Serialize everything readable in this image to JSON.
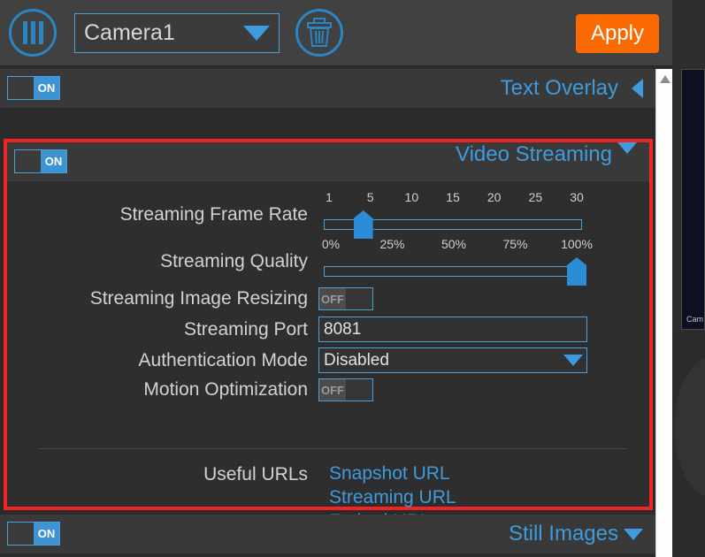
{
  "toolbar": {
    "menu_icon": "bars-icon",
    "camera_select": {
      "value": "Camera1",
      "dropdown_icon": "chevron-down-icon"
    },
    "delete_icon": "trash-icon",
    "apply_label": "Apply"
  },
  "scrollbar": {
    "up_arrow_icon": "scroll-up-arrow-icon"
  },
  "preview": {
    "camera_label": "Cam"
  },
  "sections": {
    "text_overlay": {
      "title": "Text Overlay",
      "toggle": "ON",
      "collapsed_icon": "chevron-left-icon"
    },
    "video_streaming": {
      "title": "Video Streaming",
      "toggle": "ON",
      "expanded_icon": "chevron-down-icon"
    },
    "still_images": {
      "title": "Still Images",
      "toggle": "ON",
      "expanded_icon": "chevron-down-icon"
    }
  },
  "video_streaming": {
    "frame_rate": {
      "label": "Streaming Frame Rate",
      "ticks": [
        "1",
        "5",
        "10",
        "15",
        "20",
        "25",
        "30"
      ],
      "value": 5,
      "min": 1,
      "max": 30
    },
    "quality": {
      "label": "Streaming Quality",
      "ticks": [
        "0%",
        "25%",
        "50%",
        "75%",
        "100%"
      ],
      "value": 100,
      "min": 0,
      "max": 100
    },
    "image_resizing": {
      "label": "Streaming Image Resizing",
      "value": "OFF"
    },
    "port": {
      "label": "Streaming Port",
      "value": "8081"
    },
    "auth_mode": {
      "label": "Authentication Mode",
      "value": "Disabled"
    },
    "motion_optimization": {
      "label": "Motion Optimization",
      "value": "OFF"
    },
    "useful_urls": {
      "label": "Useful URLs",
      "links": [
        "Snapshot URL",
        "Streaming URL",
        "Embed URL"
      ]
    }
  },
  "colors": {
    "accent_blue": "#3e9bdd",
    "apply_orange": "#fa6a01",
    "highlight_red": "#f42424",
    "panel_bg": "#2e2e2e",
    "header_bg": "#393939"
  }
}
